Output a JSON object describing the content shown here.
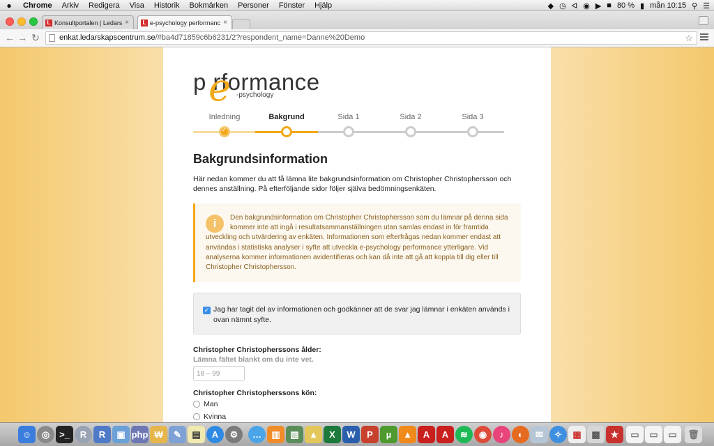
{
  "menubar": {
    "apple": "",
    "items": [
      "Chrome",
      "Arkiv",
      "Redigera",
      "Visa",
      "Historik",
      "Bokmärken",
      "Personer",
      "Fönster",
      "Hjälp"
    ],
    "battery": "80 %",
    "clock": "mån 10:15"
  },
  "tabs": [
    {
      "favicon": "L",
      "title": "Konsultportalen | Ledarska"
    },
    {
      "favicon": "L",
      "title": "e-psychology performance"
    }
  ],
  "address": {
    "host": "enkat.ledarskapscentrum.se",
    "path": "/#ba4d71859c6b6231/2?respondent_name=Danne%20Demo"
  },
  "logo": {
    "main": "p rformance",
    "accent_letter": "e",
    "sub": "-psychology"
  },
  "steps": [
    {
      "label": "Inledning",
      "state": "done"
    },
    {
      "label": "Bakgrund",
      "state": "active"
    },
    {
      "label": "Sida 1",
      "state": "todo"
    },
    {
      "label": "Sida 2",
      "state": "todo"
    },
    {
      "label": "Sida 3",
      "state": "todo"
    }
  ],
  "page": {
    "title": "Bakgrundsinformation",
    "intro": "Här nedan kommer du att få lämna lite bakgrundsinformation om Christopher Christophersson och dennes anställning. På efterföljande sidor följer själva bedömningsenkäten.",
    "info_icon": "i",
    "notice": "Den bakgrundsinformation om Christopher Christophersson som du lämnar på denna sida kommer inte att ingå i resultatsammanställningen utan samlas endast in för framtida utveckling och utvärdering av enkäten. Informationen som efterfrågas nedan kommer endast att användas i statistiska analyser i syfte att utveckla e-psychology performance ytterligare. Vid analyserna kommer informationen avidentifieras och kan då inte att gå att koppla till dig eller till Christopher Christophersson.",
    "consent_check": "✓",
    "consent": "Jag har tagit del av informationen och godkänner att de svar jag lämnar i enkäten används i ovan nämnt syfte.",
    "age_label": "Christopher Christopherssons ålder:",
    "age_hint": "Lämna fältet blankt om du inte vet.",
    "age_placeholder": "18 – 99",
    "gender_label": "Christopher Christopherssons kön:",
    "gender_options": [
      "Man",
      "Kvinna"
    ]
  },
  "colors": {
    "accent": "#f2a818",
    "background": "#f3c97a"
  }
}
